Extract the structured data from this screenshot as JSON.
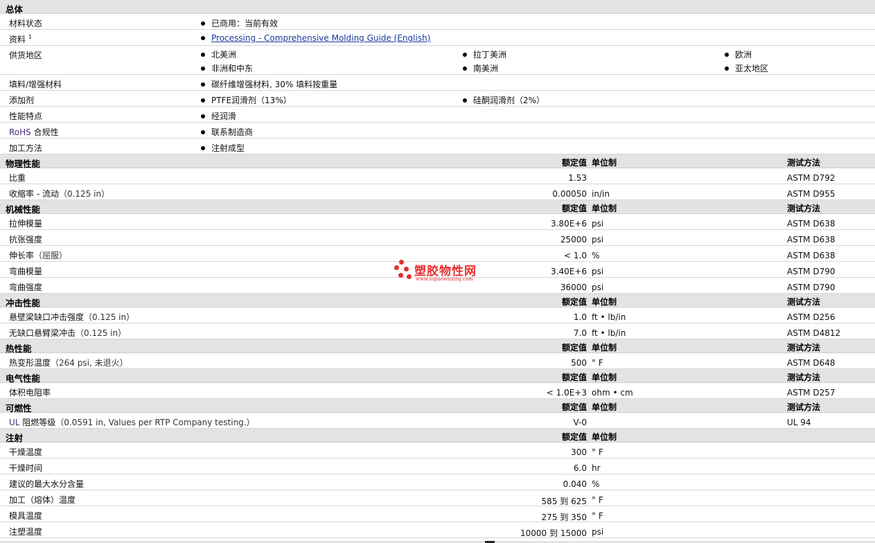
{
  "sections": {
    "general": {
      "title": "总体"
    },
    "physical": {
      "title": "物理性能"
    },
    "mechanical": {
      "title": "机械性能"
    },
    "impact": {
      "title": "冲击性能"
    },
    "thermal": {
      "title": "热性能"
    },
    "electrical": {
      "title": "电气性能"
    },
    "flammability": {
      "title": "可燃性"
    },
    "injection": {
      "title": "注射"
    }
  },
  "col_headers": {
    "value": "额定值",
    "unit": "单位制",
    "method": "测试方法"
  },
  "general_rows": {
    "status": {
      "label": "材料状态",
      "value": "已商用：当前有效"
    },
    "docs": {
      "label": "资料",
      "sup": "1",
      "link": "Processing - Comprehensive Molding Guide (English)"
    },
    "region": {
      "label": "供货地区",
      "items": [
        "北美洲",
        "拉丁美洲",
        "欧洲",
        "非洲和中东",
        "南美洲",
        "亚太地区"
      ]
    },
    "filler": {
      "label": "填料/增强材料",
      "value": "碳纤维增强材料, 30% 填料按重量"
    },
    "additive": {
      "label": "添加剂",
      "items": [
        "PTFE润滑剂（13%）",
        "硅酮润滑剂（2%）"
      ]
    },
    "features": {
      "label": "性能特点",
      "value": "经润滑"
    },
    "rohs": {
      "label_accent": "RoHS",
      "label_rest": " 合规性",
      "value": "联系制造商"
    },
    "process": {
      "label": "加工方法",
      "value": "注射成型"
    }
  },
  "physical_rows": [
    {
      "label": "比重",
      "cond": "",
      "value": "1.53",
      "unit": "",
      "method": "ASTM D792"
    },
    {
      "label": "收缩率 - 流动",
      "cond": "（0.125 in）",
      "value": "0.00050",
      "unit": "in/in",
      "method": "ASTM D955"
    }
  ],
  "mechanical_rows": [
    {
      "label": "拉伸模量",
      "cond": "",
      "value": "3.80E+6",
      "unit": "psi",
      "method": "ASTM D638"
    },
    {
      "label": "抗张强度",
      "cond": "",
      "value": "25000",
      "unit": "psi",
      "method": "ASTM D638"
    },
    {
      "label": "伸长率",
      "cond": "（屈服）",
      "value": "< 1.0",
      "unit": "%",
      "method": "ASTM D638"
    },
    {
      "label": "弯曲模量",
      "cond": "",
      "value": "3.40E+6",
      "unit": "psi",
      "method": "ASTM D790"
    },
    {
      "label": "弯曲强度",
      "cond": "",
      "value": "36000",
      "unit": "psi",
      "method": "ASTM D790"
    }
  ],
  "impact_rows": [
    {
      "label": "悬壁梁缺口冲击强度",
      "cond": "（0.125 in）",
      "value": "1.0",
      "unit": "ft • lb/in",
      "method": "ASTM D256"
    },
    {
      "label": "无缺口悬臂梁冲击",
      "cond": "（0.125 in）",
      "value": "7.0",
      "unit": "ft • lb/in",
      "method": "ASTM D4812"
    }
  ],
  "thermal_rows": [
    {
      "label": "热变形温度",
      "cond": "（264 psi, 未退火）",
      "value": "500",
      "unit": "°  F",
      "method": "ASTM D648"
    }
  ],
  "electrical_rows": [
    {
      "label": "体积电阻率",
      "cond": "",
      "value": "< 1.0E+3",
      "unit": "ohm • cm",
      "method": "ASTM D257"
    }
  ],
  "flammability_rows": [
    {
      "label_accent": "UL",
      "label": " 阻燃等级",
      "cond": "（0.0591 in, Values per RTP Company testing.）",
      "value": "V-0",
      "unit": "",
      "method": "UL 94"
    }
  ],
  "injection_rows": [
    {
      "label": "干燥温度",
      "value": "300",
      "unit": "°  F"
    },
    {
      "label": "干燥时间",
      "value": "6.0",
      "unit": "hr"
    },
    {
      "label": "建议的最大水分含量",
      "value": "0.040",
      "unit": "%"
    },
    {
      "label": "加工（熔体）温度",
      "value": "585 到  625",
      "unit": "°  F"
    },
    {
      "label": "模具温度",
      "value": "275 到  350",
      "unit": "°  F"
    },
    {
      "label": "注塑温度",
      "value": "10000 到  15000",
      "unit": "psi"
    }
  ],
  "watermark": {
    "brand": "塑胶物性网",
    "url": "www.sujiaowuxing.com"
  },
  "colors": {
    "header_bg": "#e3e3e3",
    "link": "#1a3a9a",
    "accent": "#4a2b7a",
    "watermark": "#e53030"
  }
}
